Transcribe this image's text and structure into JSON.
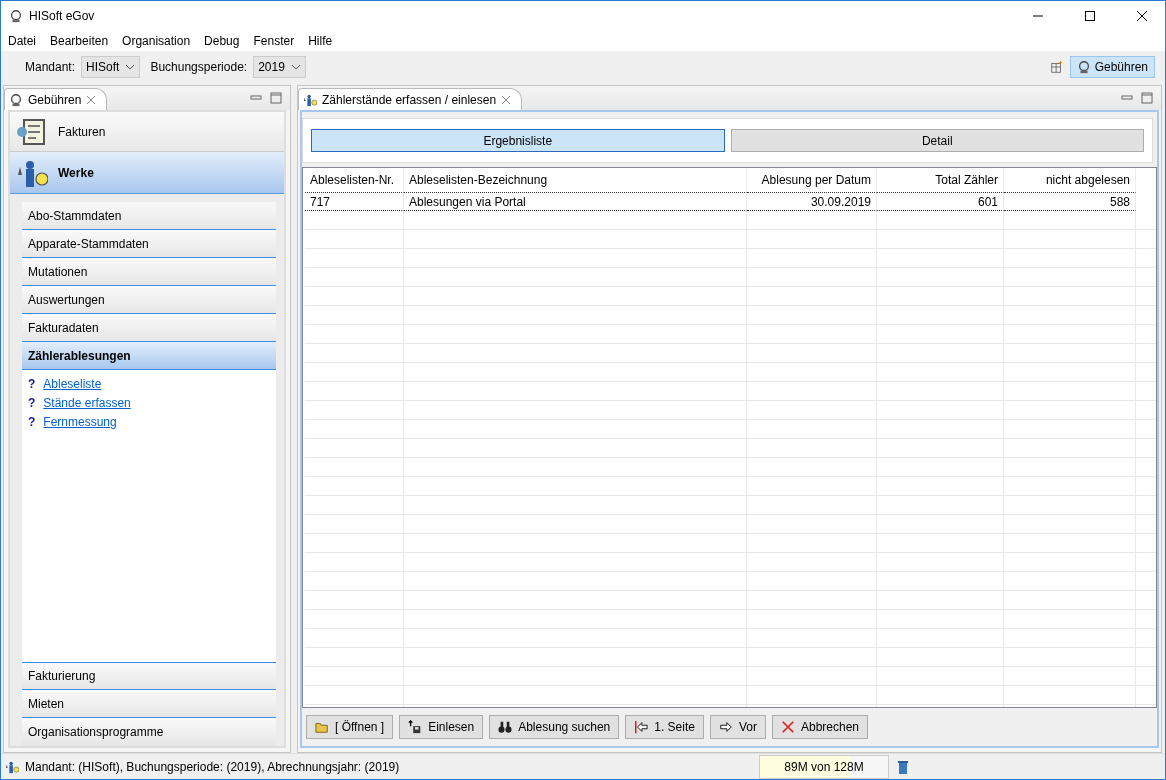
{
  "window": {
    "title": "HISoft eGov"
  },
  "menu": [
    "Datei",
    "Bearbeiten",
    "Organisation",
    "Debug",
    "Fenster",
    "Hilfe"
  ],
  "toolbar": {
    "mandant_label": "Mandant:",
    "mandant_value": "HISoft",
    "periode_label": "Buchungsperiode:",
    "periode_value": "2019",
    "perspective_button": "Gebühren"
  },
  "left_panel": {
    "tab": "Gebühren",
    "sections": [
      {
        "label": "Fakturen",
        "selected": false
      },
      {
        "label": "Werke",
        "selected": true
      }
    ],
    "groups": [
      {
        "label": "Abo-Stammdaten",
        "selected": false
      },
      {
        "label": "Apparate-Stammdaten",
        "selected": false
      },
      {
        "label": "Mutationen",
        "selected": false
      },
      {
        "label": "Auswertungen",
        "selected": false
      },
      {
        "label": "Fakturadaten",
        "selected": false
      },
      {
        "label": "Zählerablesungen",
        "selected": true
      }
    ],
    "links": [
      {
        "mark": "?",
        "label": "Ableseliste"
      },
      {
        "mark": "?",
        "label": "Stände erfassen"
      },
      {
        "mark": "?",
        "label": "Fernmessung"
      }
    ],
    "bottom_sections": [
      "Fakturierung",
      "Mieten",
      "Organisationsprogramme"
    ]
  },
  "editor": {
    "tab": "Zählerstände erfassen / einlesen",
    "view_tabs": [
      {
        "label": "Ergebnisliste",
        "selected": true
      },
      {
        "label": "Detail",
        "selected": false
      }
    ],
    "table": {
      "columns": [
        "Ableselisten-Nr.",
        "Ableselisten-Bezeichnung",
        "Ablesung per Datum",
        "Total Zähler",
        "nicht abgelesen"
      ],
      "rows": [
        {
          "cells": [
            "717",
            "Ablesungen via Portal",
            "30.09.2019",
            "601",
            "588"
          ],
          "selected": true
        }
      ]
    },
    "buttons": [
      {
        "kind": "open",
        "label": "[ Öffnen ]"
      },
      {
        "kind": "import",
        "label": "Einlesen"
      },
      {
        "kind": "search",
        "label": "Ablesung suchen"
      },
      {
        "kind": "first",
        "label": "1. Seite"
      },
      {
        "kind": "next",
        "label": "Vor"
      },
      {
        "kind": "cancel",
        "label": "Abbrechen"
      }
    ]
  },
  "status_bar": {
    "text": "Mandant: (HISoft), Buchungsperiode: (2019), Abrechnungsjahr: (2019)",
    "memory": {
      "text": "89M von 128M",
      "level": 0.7
    }
  }
}
